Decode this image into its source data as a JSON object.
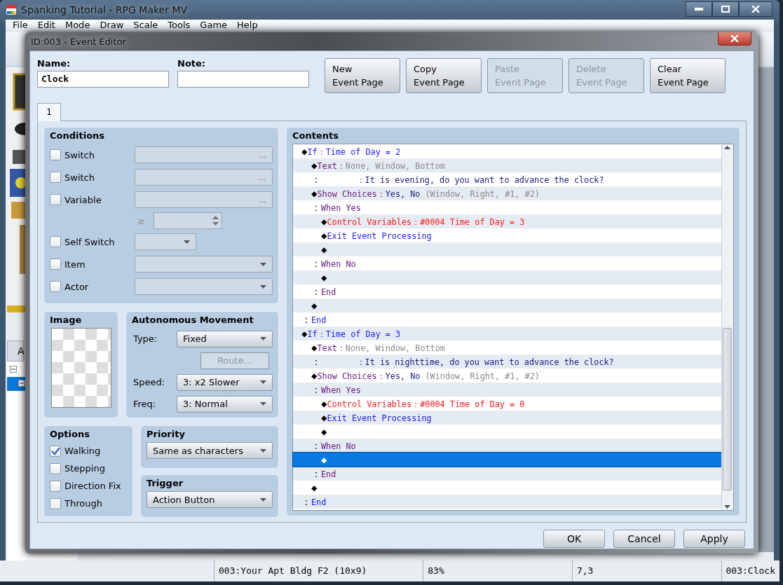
{
  "app_window": {
    "title": "Spanking Tutorial - RPG Maker MV",
    "menu": [
      "File",
      "Edit",
      "Mode",
      "Draw",
      "Scale",
      "Tools",
      "Game",
      "Help"
    ],
    "tree_tab": "A"
  },
  "dialog": {
    "title": "ID:003 - Event Editor",
    "name_label": "Name:",
    "name": "Clock",
    "note_label": "Note:",
    "page_buttons": [
      {
        "lines": [
          "New",
          "Event Page"
        ],
        "disabled": false
      },
      {
        "lines": [
          "Copy",
          "Event Page"
        ],
        "disabled": false
      },
      {
        "lines": [
          "Paste",
          "Event Page"
        ],
        "disabled": true
      },
      {
        "lines": [
          "Delete",
          "Event Page"
        ],
        "disabled": true
      },
      {
        "lines": [
          "Clear",
          "Event Page"
        ],
        "disabled": false
      }
    ],
    "page_tabs": [
      {
        "label": "1",
        "selected": true
      }
    ],
    "conditions": {
      "title": "Conditions",
      "rows": [
        {
          "kind": "picker",
          "label": "Switch",
          "checked": false,
          "button": "..."
        },
        {
          "kind": "picker",
          "label": "Switch",
          "checked": false,
          "button": "..."
        },
        {
          "kind": "picker",
          "label": "Variable",
          "checked": false,
          "button": "..."
        },
        {
          "kind": "spinner",
          "symbol": "≥"
        },
        {
          "kind": "short_select",
          "label": "Self Switch",
          "checked": false
        },
        {
          "kind": "select",
          "label": "Item",
          "checked": false
        },
        {
          "kind": "select",
          "label": "Actor",
          "checked": false
        }
      ]
    },
    "image": {
      "title": "Image"
    },
    "movement": {
      "title": "Autonomous Movement",
      "rows": [
        {
          "kind": "select",
          "label": "Type:",
          "value": "Fixed"
        },
        {
          "kind": "button",
          "label": "Route...",
          "disabled": true
        },
        {
          "kind": "select",
          "label": "Speed:",
          "value": "3: x2 Slower"
        },
        {
          "kind": "select",
          "label": "Freq:",
          "value": "3: Normal"
        }
      ]
    },
    "options": {
      "title": "Options",
      "items": [
        {
          "label": "Walking",
          "checked": true
        },
        {
          "label": "Stepping",
          "checked": false
        },
        {
          "label": "Direction Fix",
          "checked": false
        },
        {
          "label": "Through",
          "checked": false
        }
      ]
    },
    "priority": {
      "title": "Priority",
      "value": "Same as characters"
    },
    "trigger": {
      "title": "Trigger",
      "value": "Action Button"
    },
    "contents": {
      "title": "Contents",
      "commands": [
        {
          "selected": false,
          "segments": [
            {
              "text": "◆",
              "kind": "marker"
            },
            {
              "text": "If：Time of Day = 2",
              "kind": "flow"
            }
          ],
          "children": [
            {
              "selected": false,
              "segments": [
                {
                  "text": "◆",
                  "kind": "marker"
                },
                {
                  "text": "Text：",
                  "kind": "command"
                },
                {
                  "text": "None, Window, Bottom",
                  "kind": "note"
                }
              ]
            },
            {
              "selected": false,
              "segments": [
                {
                  "text": "：      ",
                  "kind": "marker"
                },
                {
                  "text": "：It is evening, do you want to advance the clock?",
                  "kind": "message"
                }
              ]
            },
            {
              "selected": false,
              "segments": [
                {
                  "text": "◆",
                  "kind": "marker"
                },
                {
                  "text": "Show Choices：",
                  "kind": "command"
                },
                {
                  "text": "Yes, No ",
                  "kind": "message"
                },
                {
                  "text": "(Window, Right, #1, #2)",
                  "kind": "note"
                }
              ]
            },
            {
              "selected": false,
              "segments": [
                {
                  "text": "：",
                  "kind": "marker"
                },
                {
                  "text": "When Yes",
                  "kind": "command"
                }
              ],
              "children": [
                {
                  "selected": false,
                  "segments": [
                    {
                      "text": "◆",
                      "kind": "marker"
                    },
                    {
                      "text": "Control Variables：#0004 Time of Day = 3",
                      "kind": "variable"
                    }
                  ]
                },
                {
                  "selected": false,
                  "segments": [
                    {
                      "text": "◆",
                      "kind": "marker"
                    },
                    {
                      "text": "Exit Event Processing",
                      "kind": "flow"
                    }
                  ]
                },
                {
                  "selected": false,
                  "segments": [
                    {
                      "text": "◆",
                      "kind": "marker"
                    }
                  ]
                }
              ]
            },
            {
              "selected": false,
              "segments": [
                {
                  "text": "：",
                  "kind": "marker"
                },
                {
                  "text": "When No",
                  "kind": "command"
                }
              ],
              "children": [
                {
                  "selected": false,
                  "segments": [
                    {
                      "text": "◆",
                      "kind": "marker"
                    }
                  ]
                }
              ]
            },
            {
              "selected": false,
              "segments": [
                {
                  "text": "：",
                  "kind": "marker"
                },
                {
                  "text": "End",
                  "kind": "command"
                }
              ]
            },
            {
              "selected": false,
              "segments": [
                {
                  "text": "◆",
                  "kind": "marker"
                }
              ]
            }
          ]
        },
        {
          "selected": false,
          "segments": [
            {
              "text": "：",
              "kind": "marker"
            },
            {
              "text": "End",
              "kind": "flow"
            }
          ]
        },
        {
          "selected": false,
          "segments": [
            {
              "text": "◆",
              "kind": "marker"
            },
            {
              "text": "If：Time of Day = 3",
              "kind": "flow"
            }
          ],
          "children": [
            {
              "selected": false,
              "segments": [
                {
                  "text": "◆",
                  "kind": "marker"
                },
                {
                  "text": "Text：",
                  "kind": "command"
                },
                {
                  "text": "None, Window, Bottom",
                  "kind": "note"
                }
              ]
            },
            {
              "selected": false,
              "segments": [
                {
                  "text": "：      ",
                  "kind": "marker"
                },
                {
                  "text": "：It is nighttime, do you want to advance the clock?",
                  "kind": "message"
                }
              ]
            },
            {
              "selected": false,
              "segments": [
                {
                  "text": "◆",
                  "kind": "marker"
                },
                {
                  "text": "Show Choices：",
                  "kind": "command"
                },
                {
                  "text": "Yes, No ",
                  "kind": "message"
                },
                {
                  "text": "(Window, Right, #1, #2)",
                  "kind": "note"
                }
              ]
            },
            {
              "selected": false,
              "segments": [
                {
                  "text": "：",
                  "kind": "marker"
                },
                {
                  "text": "When Yes",
                  "kind": "command"
                }
              ],
              "children": [
                {
                  "selected": false,
                  "segments": [
                    {
                      "text": "◆",
                      "kind": "marker"
                    },
                    {
                      "text": "Control Variables：#0004 Time of Day = 0",
                      "kind": "variable"
                    }
                  ]
                },
                {
                  "selected": false,
                  "segments": [
                    {
                      "text": "◆",
                      "kind": "marker"
                    },
                    {
                      "text": "Exit Event Processing",
                      "kind": "flow"
                    }
                  ]
                },
                {
                  "selected": false,
                  "segments": [
                    {
                      "text": "◆",
                      "kind": "marker"
                    }
                  ]
                }
              ]
            },
            {
              "selected": false,
              "segments": [
                {
                  "text": "：",
                  "kind": "marker"
                },
                {
                  "text": "When No",
                  "kind": "command"
                }
              ],
              "children": [
                {
                  "selected": true,
                  "segments": [
                    {
                      "text": "◆",
                      "kind": "marker"
                    }
                  ]
                }
              ]
            },
            {
              "selected": false,
              "segments": [
                {
                  "text": "：",
                  "kind": "marker"
                },
                {
                  "text": "End",
                  "kind": "command"
                }
              ]
            },
            {
              "selected": false,
              "segments": [
                {
                  "text": "◆",
                  "kind": "marker"
                }
              ]
            }
          ]
        },
        {
          "selected": false,
          "segments": [
            {
              "text": "：",
              "kind": "marker"
            },
            {
              "text": "End",
              "kind": "flow"
            }
          ]
        }
      ]
    },
    "footer_buttons": [
      "OK",
      "Cancel",
      "Apply"
    ]
  },
  "status_bar": [
    "003:Your Apt Bldg F2 (10x9)",
    "83%",
    "7,3",
    "003:Clock"
  ]
}
